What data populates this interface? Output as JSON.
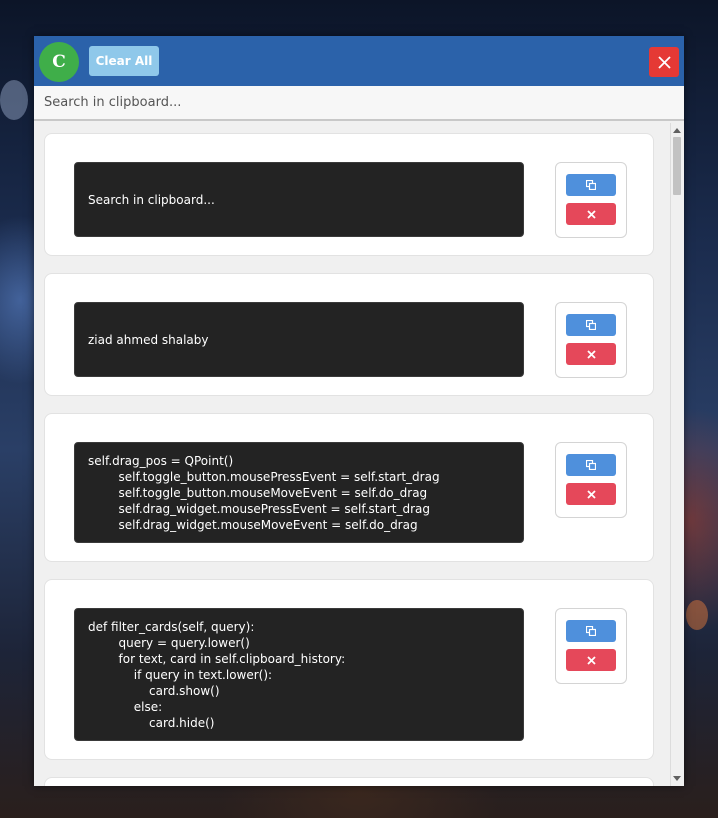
{
  "header": {
    "avatar_letter": "C",
    "clear_label": "Clear All",
    "close_icon": "close-icon",
    "color": "#2b62aa"
  },
  "search": {
    "placeholder": "Search in clipboard...",
    "value": ""
  },
  "cards": [
    {
      "text": "Search in clipboard...",
      "copy_icon": "copy-icon",
      "delete_icon": "delete-icon"
    },
    {
      "text": "ziad ahmed shalaby",
      "copy_icon": "copy-icon",
      "delete_icon": "delete-icon"
    },
    {
      "text": "self.drag_pos = QPoint()\n        self.toggle_button.mousePressEvent = self.start_drag\n        self.toggle_button.mouseMoveEvent = self.do_drag\n        self.drag_widget.mousePressEvent = self.start_drag\n        self.drag_widget.mouseMoveEvent = self.do_drag",
      "copy_icon": "copy-icon",
      "delete_icon": "delete-icon"
    },
    {
      "text": "def filter_cards(self, query):\n        query = query.lower()\n        for text, card in self.clipboard_history:\n            if query in text.lower():\n                card.show()\n            else:\n                card.hide()",
      "copy_icon": "copy-icon",
      "delete_icon": "delete-icon"
    }
  ],
  "colors": {
    "avatar": "#3fae49",
    "clear_button": "#8fc8ea",
    "close_button": "#e53935",
    "copy_button": "#4f90dc",
    "delete_button": "#e5485a",
    "snippet_background": "#232323"
  }
}
